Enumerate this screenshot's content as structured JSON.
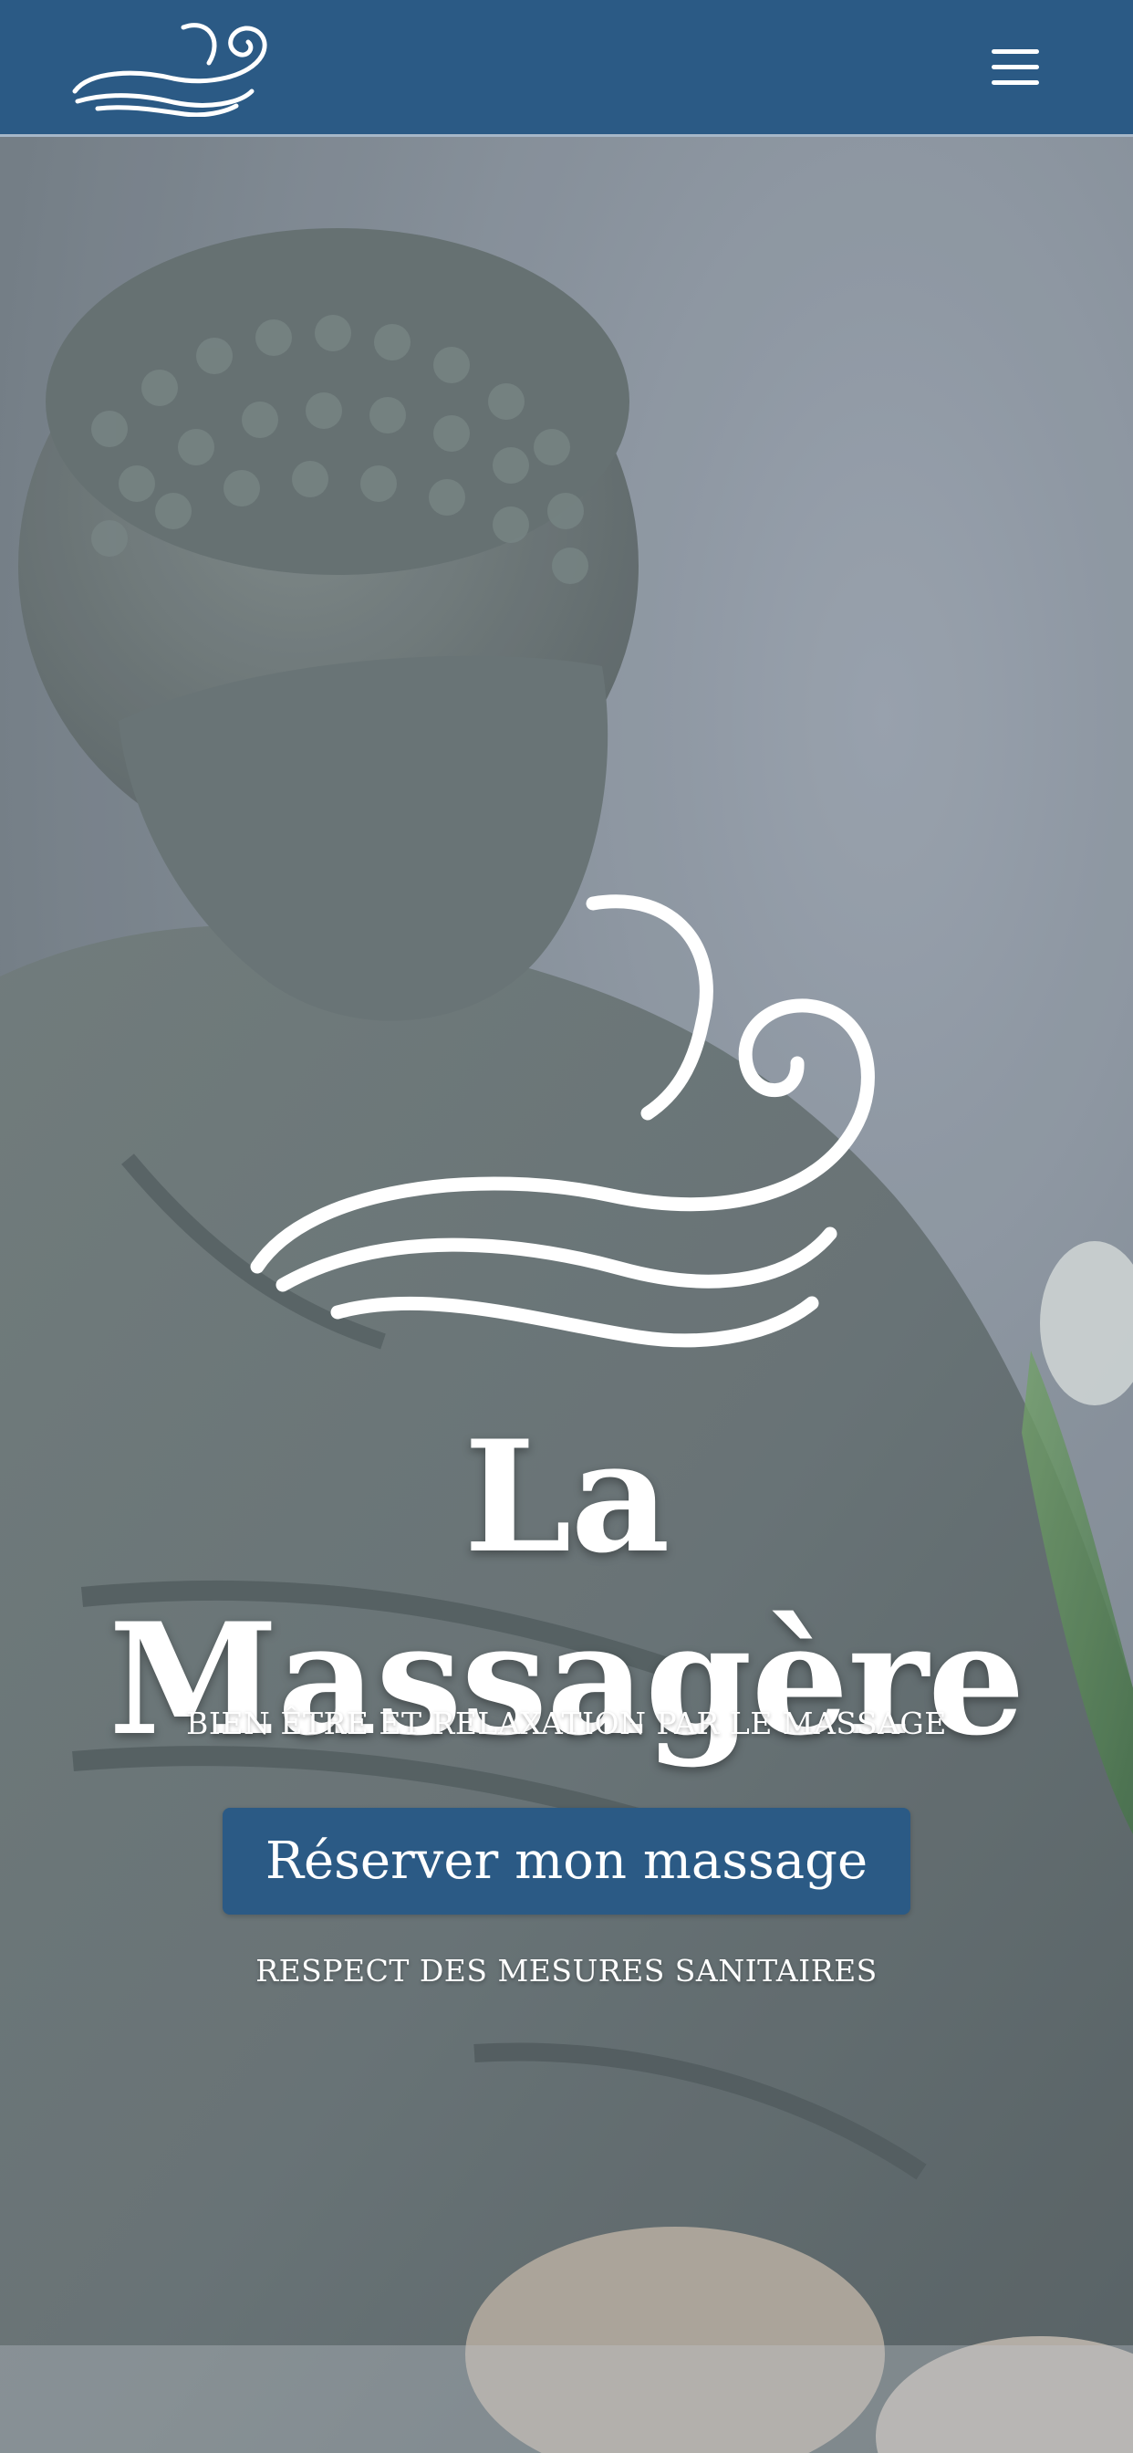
{
  "header": {
    "logo_icon": "wind-swirl-logo",
    "menu_icon": "hamburger-menu-icon",
    "background_color": "#2b5a85"
  },
  "hero": {
    "logo_icon": "wind-swirl-logo",
    "title": "La Massagère",
    "subtitle": "BIEN ÊTRE ET RELAXATION PAR LE MASSAGE",
    "cta_label": "Réserver mon massage",
    "note": "RESPECT DES MESURES SANITAIRES",
    "background_image": "buddha-statue-photo",
    "accent_color": "#2b5a85",
    "text_color": "#ffffff"
  }
}
